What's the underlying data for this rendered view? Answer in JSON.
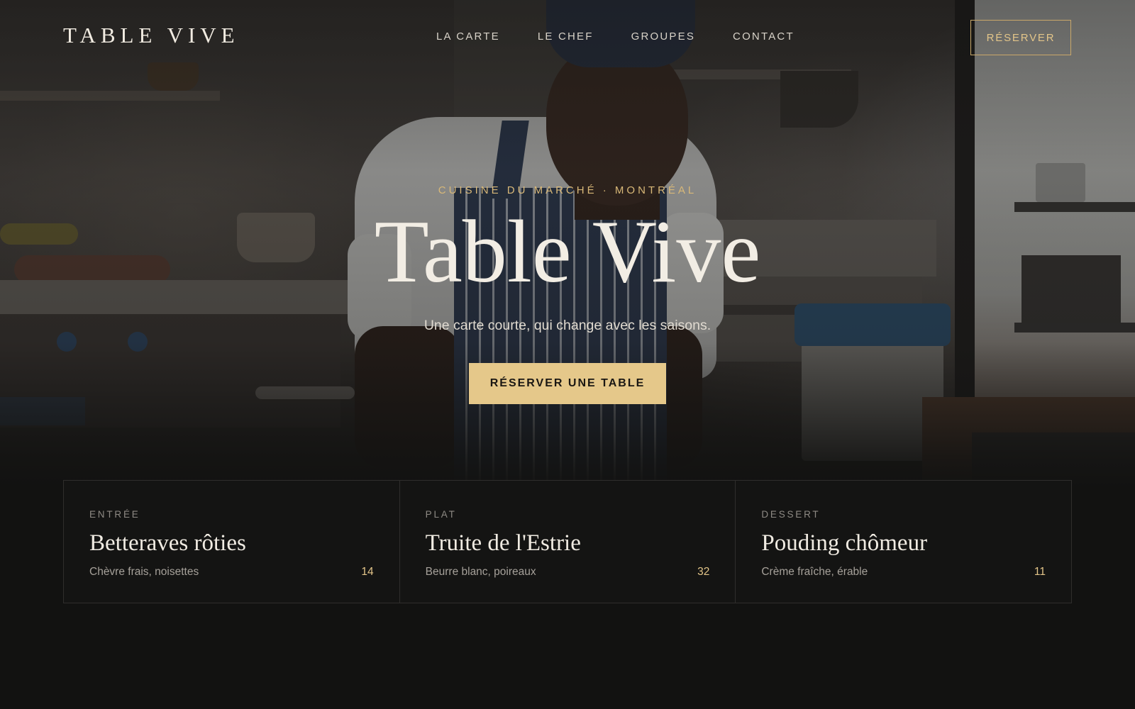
{
  "nav": {
    "logo": "TABLE VIVE",
    "items": [
      {
        "label": "LA CARTE"
      },
      {
        "label": "LE CHEF"
      },
      {
        "label": "GROUPES"
      },
      {
        "label": "CONTACT"
      }
    ],
    "reserve_label": "RÉSERVER"
  },
  "hero": {
    "eyebrow": "CUISINE DU MARCHÉ · MONTRÉAL",
    "title": "Table Vive",
    "subtitle": "Une carte courte, qui change avec les saisons.",
    "cta_label": "RÉSERVER UNE TABLE"
  },
  "menu": {
    "cards": [
      {
        "category": "ENTRÉE",
        "name": "Betteraves rôties",
        "description": "Chèvre frais, noisettes",
        "price": "14"
      },
      {
        "category": "PLAT",
        "name": "Truite de l'Estrie",
        "description": "Beurre blanc, poireaux",
        "price": "32"
      },
      {
        "category": "DESSERT",
        "name": "Pouding chômeur",
        "description": "Crème fraîche, érable",
        "price": "11"
      }
    ]
  },
  "colors": {
    "background": "#121211",
    "accent": "#e5c88a",
    "accent_text": "#d8b878",
    "text_light": "#f2ede4"
  }
}
